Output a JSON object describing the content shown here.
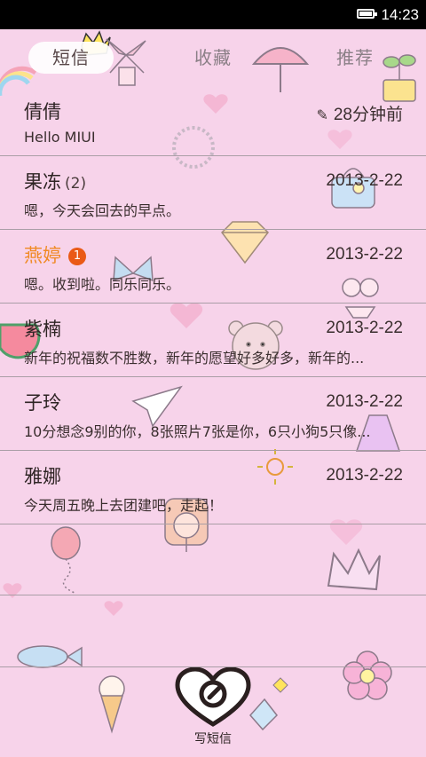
{
  "status_bar": {
    "time": "14:23"
  },
  "tabs": [
    {
      "label": "短信",
      "active": true
    },
    {
      "label": "收藏",
      "active": false
    },
    {
      "label": "推荐",
      "active": false
    }
  ],
  "conversations": [
    {
      "name": "倩倩",
      "count": "",
      "badge": "",
      "date": "28分钟前",
      "draft": true,
      "snippet": "Hello MIUI",
      "unread": false
    },
    {
      "name": "果冻",
      "count": "(2)",
      "badge": "",
      "date": "2013-2-22",
      "draft": false,
      "snippet": "嗯，今天会回去的早点。",
      "unread": false
    },
    {
      "name": "燕婷",
      "count": "",
      "badge": "1",
      "date": "2013-2-22",
      "draft": false,
      "snippet": "嗯。收到啦。同乐同乐。",
      "unread": true
    },
    {
      "name": "紫楠",
      "count": "",
      "badge": "",
      "date": "2013-2-22",
      "draft": false,
      "snippet": "新年的祝福数不胜数，新年的愿望好多好多，新年的...",
      "unread": false
    },
    {
      "name": "子玲",
      "count": "",
      "badge": "",
      "date": "2013-2-22",
      "draft": false,
      "snippet": "10分想念9别的你，8张照片7张是你，6只小狗5只像...",
      "unread": false
    },
    {
      "name": "雅娜",
      "count": "",
      "badge": "",
      "date": "2013-2-22",
      "draft": false,
      "snippet": "今天周五晚上去团建吧，走起！",
      "unread": false
    }
  ],
  "compose": {
    "label": "写短信",
    "icon": "heart-pen-icon"
  },
  "colors": {
    "background": "#f7d3ea",
    "unread_name": "#f08a24",
    "badge": "#ea5a16"
  }
}
